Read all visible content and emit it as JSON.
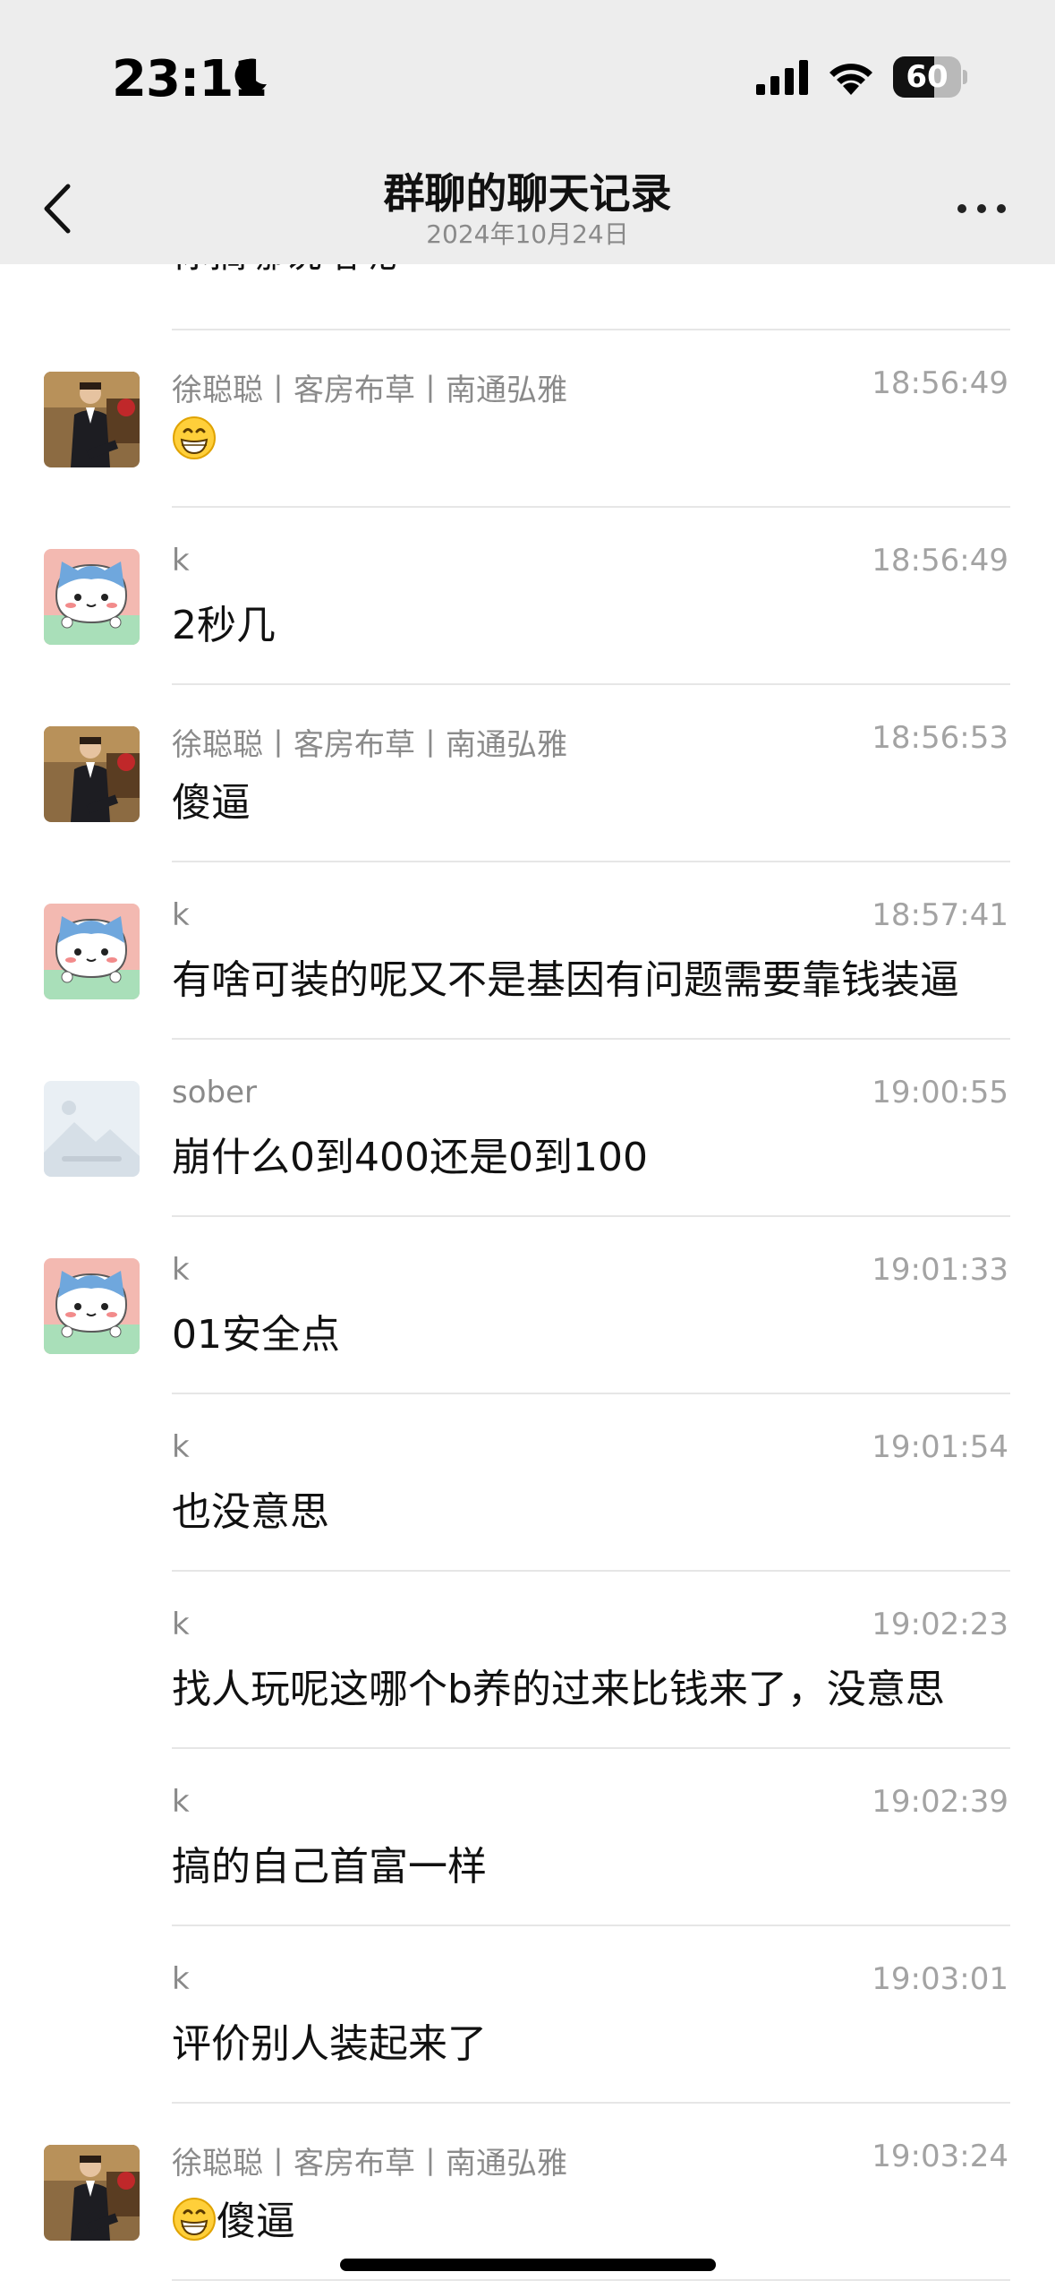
{
  "status_bar": {
    "time": "23:11",
    "battery": "60",
    "battery_level": 0.6
  },
  "nav": {
    "title": "群聊的聊天记录",
    "subtitle": "2024年10月24日"
  },
  "partial_message": "你搞哪说啥呢",
  "messages": [
    {
      "sender": "徐聪聪丨客房布草丨南通弘雅",
      "time": "18:56:49",
      "text": "",
      "emoji": "grinning-face",
      "avatar": "photo-man-suit"
    },
    {
      "sender": "k",
      "time": "18:56:49",
      "text": "2秒几",
      "emoji": "",
      "avatar": "cartoon-cat"
    },
    {
      "sender": "徐聪聪丨客房布草丨南通弘雅",
      "time": "18:56:53",
      "text": "傻逼",
      "emoji": "",
      "avatar": "photo-man-suit"
    },
    {
      "sender": "k",
      "time": "18:57:41",
      "text": "有啥可装的呢又不是基因有问题需要靠钱装逼",
      "emoji": "",
      "avatar": "cartoon-cat"
    },
    {
      "sender": "sober",
      "time": "19:00:55",
      "text": "崩什么0到400还是0到100",
      "emoji": "",
      "avatar": "placeholder-mountain"
    },
    {
      "sender": "k",
      "time": "19:01:33",
      "text": "01安全点",
      "emoji": "",
      "avatar": "cartoon-cat"
    },
    {
      "sender": "k",
      "time": "19:01:54",
      "text": "也没意思",
      "emoji": "",
      "avatar": ""
    },
    {
      "sender": "k",
      "time": "19:02:23",
      "text": "找人玩呢这哪个b养的过来比钱来了，没意思",
      "emoji": "",
      "avatar": ""
    },
    {
      "sender": "k",
      "time": "19:02:39",
      "text": "搞的自己首富一样",
      "emoji": "",
      "avatar": ""
    },
    {
      "sender": "k",
      "time": "19:03:01",
      "text": "评价别人装起来了",
      "emoji": "",
      "avatar": ""
    },
    {
      "sender": "徐聪聪丨客房布草丨南通弘雅",
      "time": "19:03:24",
      "text": "傻逼",
      "emoji": "grinning-face",
      "avatar": "photo-man-suit"
    }
  ],
  "icons": {
    "back": "chevron-left-icon",
    "more": "more-dots-icon",
    "signal": "cellular-signal-icon",
    "wifi": "wifi-icon",
    "moon": "do-not-disturb-moon-icon"
  },
  "colors": {
    "header_bg": "#ededed",
    "separator": "#e6e6e6",
    "meta_text": "#8a8a8a",
    "time_text": "#a3a3a3"
  }
}
